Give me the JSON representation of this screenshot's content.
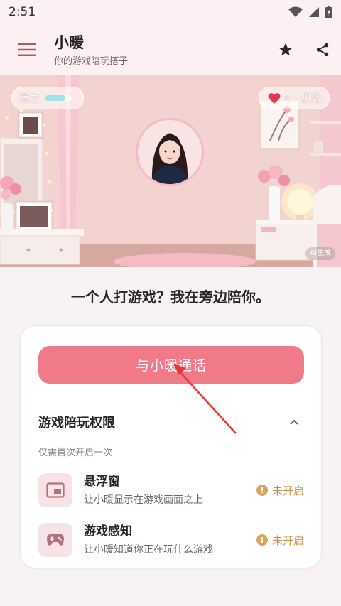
{
  "status_bar": {
    "time": "2:51",
    "icons": [
      "wifi-icon",
      "signal-icon",
      "battery-icon"
    ]
  },
  "app_bar": {
    "title": "小暖",
    "subtitle": "你的游戏陪玩搭子",
    "menu_icon": "hamburger-menu-icon",
    "favorite_icon": "star-icon",
    "share_icon": "share-icon"
  },
  "hero": {
    "vitality_label": "活力",
    "vitality_level": 0.75,
    "affinity_value": "0 · 初见",
    "affinity_icon": "heart-icon",
    "ai_badge": "AI生成"
  },
  "tagline": "一个人打游戏？我在旁边陪你。",
  "card": {
    "call_button": "与小暖通话",
    "section_title": "游戏陪玩权限",
    "section_note": "仅需首次开启一次",
    "permissions": [
      {
        "title": "悬浮窗",
        "desc": "让小暖显示在游戏画面之上",
        "status": "未开启",
        "icon": "floating-window-icon"
      },
      {
        "title": "游戏感知",
        "desc": "让小暖知道你正在玩什么游戏",
        "status": "未开启",
        "icon": "gamepad-icon"
      }
    ]
  },
  "colors": {
    "accent": "#f0798a",
    "appbar_bg": "#fdf0f3",
    "warning": "#d9a55b",
    "vitality": "#9fe3e6"
  }
}
